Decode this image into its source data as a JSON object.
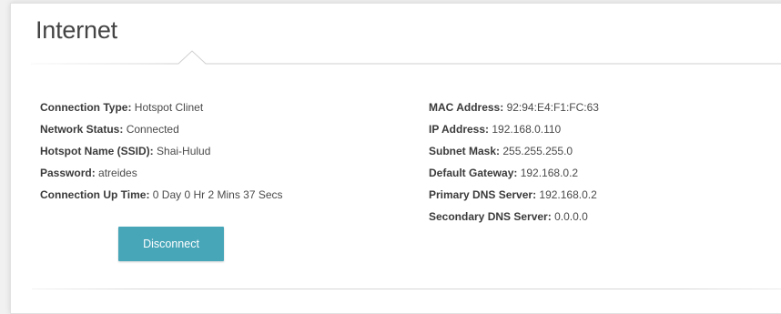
{
  "section": {
    "title": "Internet"
  },
  "left_info": [
    {
      "label": "Connection Type:",
      "value": "Hotspot Clinet"
    },
    {
      "label": "Network Status:",
      "value": "Connected"
    },
    {
      "label": "Hotspot Name (SSID):",
      "value": "Shai-Hulud"
    },
    {
      "label": "Password:",
      "value": "atreides"
    },
    {
      "label": "Connection Up Time:",
      "value": "0 Day 0 Hr 2 Mins 37 Secs"
    }
  ],
  "right_info": [
    {
      "label": "MAC Address:",
      "value": "92:94:E4:F1:FC:63"
    },
    {
      "label": "IP Address:",
      "value": "192.168.0.110"
    },
    {
      "label": "Subnet Mask:",
      "value": "255.255.255.0"
    },
    {
      "label": "Default Gateway:",
      "value": "192.168.0.2"
    },
    {
      "label": "Primary DNS Server:",
      "value": "192.168.0.2"
    },
    {
      "label": "Secondary DNS Server:",
      "value": "0.0.0.0"
    }
  ],
  "actions": {
    "disconnect_label": "Disconnect"
  },
  "colors": {
    "button": "#48a6b9",
    "panel_background": "#ffffff",
    "page_background": "#f1f1f1"
  }
}
